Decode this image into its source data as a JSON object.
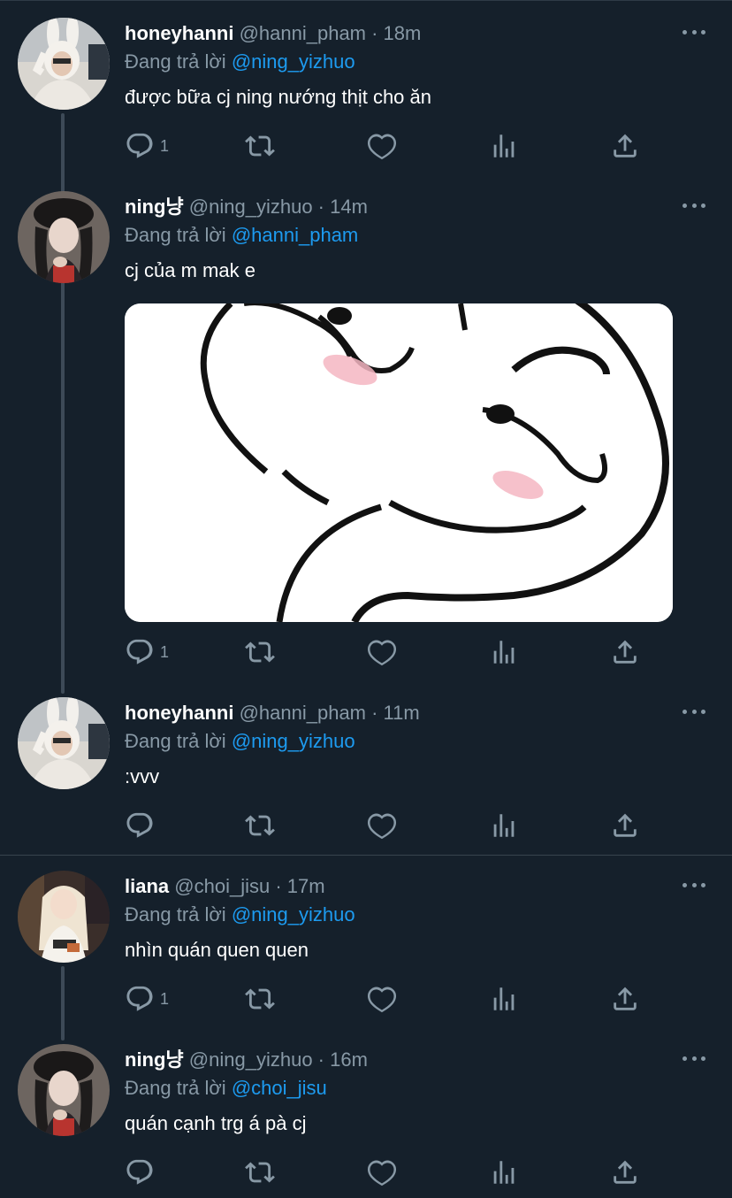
{
  "reply_label": "Đang trả lời",
  "tweets": [
    {
      "display_name": "honeyhanni",
      "meta": "@hanni_pham · 18m",
      "reply_to": "@ning_yizhuo",
      "text": "được bữa cj ning nướng thịt cho ăn",
      "reply_count": "1"
    },
    {
      "display_name": "ning냥",
      "meta": "@ning_yizhuo · 14m",
      "reply_to": "@hanni_pham",
      "text": "cj của m mak e",
      "reply_count": "1"
    },
    {
      "display_name": "honeyhanni",
      "meta": "@hanni_pham · 11m",
      "reply_to": "@ning_yizhuo",
      "text": ":vvv",
      "reply_count": ""
    },
    {
      "display_name": "liana",
      "meta": "@choi_jisu · 17m",
      "reply_to": "@ning_yizhuo",
      "text": "nhìn quán quen quen",
      "reply_count": "1"
    },
    {
      "display_name": "ning냥",
      "meta": "@ning_yizhuo · 16m",
      "reply_to": "@choi_jisu",
      "text": "quán cạnh trg á pà cj",
      "reply_count": ""
    }
  ],
  "icons": {
    "reply": "reply-icon",
    "retweet": "retweet-icon",
    "like": "heart-icon",
    "analytics": "analytics-icon",
    "share": "share-icon",
    "more": "more-icon"
  },
  "colors": {
    "background": "#15202b",
    "accent": "#1d9bf0",
    "muted": "#8899a6"
  }
}
